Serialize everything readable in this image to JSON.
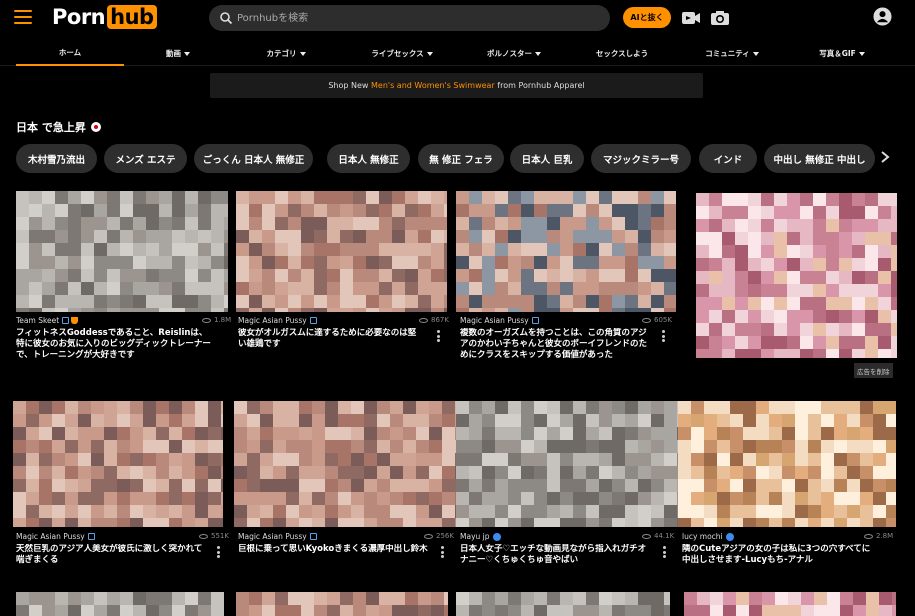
{
  "header": {
    "logo_part1": "Porn",
    "logo_part2": "hub",
    "search_placeholder": "Pornhubを検索",
    "ai_button": "AIと抜く"
  },
  "nav": [
    {
      "label": "ホーム",
      "dropdown": false,
      "active": true
    },
    {
      "label": "動画",
      "dropdown": true,
      "active": false
    },
    {
      "label": "カテゴリ",
      "dropdown": true,
      "active": false
    },
    {
      "label": "ライブセックス",
      "dropdown": true,
      "active": false
    },
    {
      "label": "ポルノスター",
      "dropdown": true,
      "active": false
    },
    {
      "label": "セックスしよう",
      "dropdown": false,
      "active": false
    },
    {
      "label": "コミュニティ",
      "dropdown": true,
      "active": false
    },
    {
      "label": "写真＆GIF",
      "dropdown": true,
      "active": false
    }
  ],
  "promo": {
    "prefix": "Shop New ",
    "highlight": "Men's and Women's Swimwear",
    "suffix": " from Pornhub Apparel"
  },
  "trending": {
    "title": "日本 で急上昇",
    "chips": [
      "木村雪乃流出",
      "メンズ エステ",
      "ごっくん 日本人 無修正",
      "日本人 無修正",
      "無 修正 フェラ",
      "日本人 巨乳",
      "マジックミラー号",
      "インド",
      "中出し 無修正 中出し"
    ]
  },
  "videos": [
    {
      "channel": "Team Skeet",
      "badge": "trophy",
      "views": "1.8M",
      "title": "フィットネスGoddessであること、Reislinは、特に彼女のお気に入りのビッグディックトレーナーで、トレーニングが大好きです"
    },
    {
      "channel": "Magic Asian Pussy",
      "badge": "verified-box",
      "views": "867K",
      "title": "彼女がオルガスムに達するために必要なのは堅い雄鶏です"
    },
    {
      "channel": "Magic Asian Pussy",
      "badge": "verified-box",
      "views": "605K",
      "title": "複数のオーガズムを持つことは、この角質のアジアのかわい子ちゃんと彼女のボーイフレンドのためにクラスをスキップする価値があった"
    },
    {
      "channel": "Magic Asian Pussy",
      "badge": "verified-box",
      "views": "551K",
      "title": "天然巨乳のアジア人美女が彼氏に激しく突かれて喘ぎまくる"
    },
    {
      "channel": "Magic Asian Pussy",
      "badge": "verified-box",
      "views": "256K",
      "title": "巨根に乗って思いKyokoきまくる濃厚中出し鈴木"
    },
    {
      "channel": "Mayu jp",
      "badge": "verified-check",
      "views": "44.1K",
      "title": "日本人女子♡エッチな動画見ながら指入れガチオナニー♡くちゅくちゅ音やばい"
    },
    {
      "channel": "lucy mochi",
      "badge": "verified-check",
      "views": "2.8M",
      "title": "隣のCuteアジアの女の子は私に3つの穴すべてに中出しさせます-Lucyもち-アナル"
    }
  ],
  "ad": {
    "remove_label": "広告を削除"
  },
  "colors": {
    "accent": "#ff9000",
    "background": "#000000",
    "chip": "#2e2e2e",
    "verified": "#3b8ef0"
  }
}
